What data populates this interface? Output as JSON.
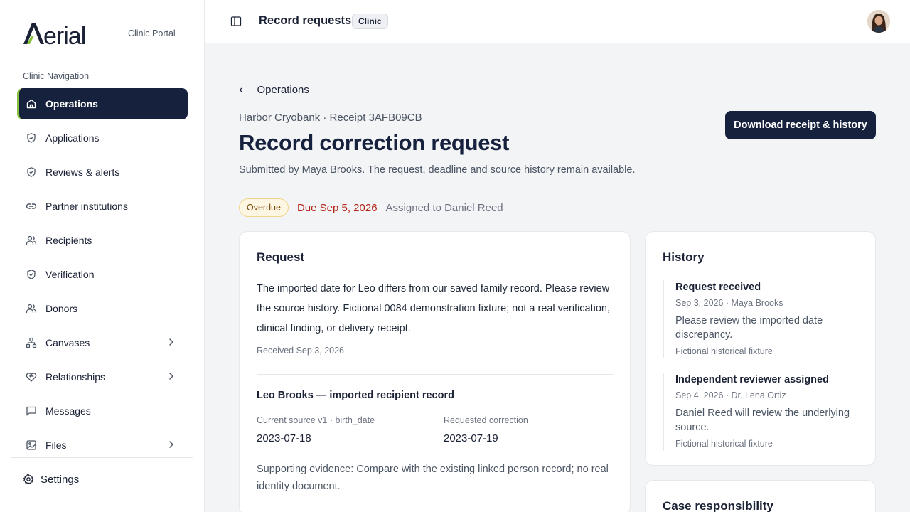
{
  "brand": {
    "name": "Aerial",
    "subtitle": "Clinic Portal",
    "accent": "#86c23c"
  },
  "sidebar": {
    "heading": "Clinic Navigation",
    "items": [
      {
        "label": "Operations",
        "icon": "home-icon",
        "active": true
      },
      {
        "label": "Applications",
        "icon": "shield-icon"
      },
      {
        "label": "Reviews & alerts",
        "icon": "shield-icon"
      },
      {
        "label": "Partner institutions",
        "icon": "link-icon"
      },
      {
        "label": "Recipients",
        "icon": "users-icon"
      },
      {
        "label": "Verification",
        "icon": "shield-icon"
      },
      {
        "label": "Donors",
        "icon": "users-icon"
      },
      {
        "label": "Canvases",
        "icon": "network-icon",
        "has_children": true
      },
      {
        "label": "Relationships",
        "icon": "heart-handshake-icon",
        "has_children": true
      },
      {
        "label": "Messages",
        "icon": "message-icon"
      },
      {
        "label": "Files",
        "icon": "image-icon",
        "has_children": true
      }
    ],
    "settings_label": "Settings"
  },
  "topbar": {
    "title": "Record requests",
    "badge": "Clinic"
  },
  "main": {
    "back_label": "Operations",
    "meta": "Harbor Cryobank · Receipt 3AFB09CB",
    "title": "Record correction request",
    "description": "Submitted by Maya Brooks. The request, deadline and source history remain available.",
    "download_label": "Download receipt & history",
    "status": {
      "badge": "Overdue",
      "due": "Due Sep 5, 2026",
      "assigned": "Assigned to Daniel Reed"
    },
    "request": {
      "title": "Request",
      "body": "The imported date for Leo differs from our saved family record. Please review the source history. Fictional 0084 demonstration fixture; not a real verification, clinical finding, or delivery receipt.",
      "received": "Received Sep 3, 2026",
      "record_title": "Leo Brooks — imported recipient record",
      "current_label": "Current source v1 · birth_date",
      "current_value": "2023-07-18",
      "requested_label": "Requested correction",
      "requested_value": "2023-07-19",
      "evidence": "Supporting evidence: Compare with the existing linked person record; no real identity document."
    },
    "history": {
      "title": "History",
      "items": [
        {
          "title": "Request received",
          "meta": "Sep 3, 2026 · Maya Brooks",
          "note": "Please review the imported date discrepancy.",
          "foot": "Fictional historical fixture"
        },
        {
          "title": "Independent reviewer assigned",
          "meta": "Sep 4, 2026 · Dr. Lena Ortiz",
          "note": "Daniel Reed will review the underlying source.",
          "foot": "Fictional historical fixture"
        }
      ]
    },
    "case_title": "Case responsibility"
  }
}
